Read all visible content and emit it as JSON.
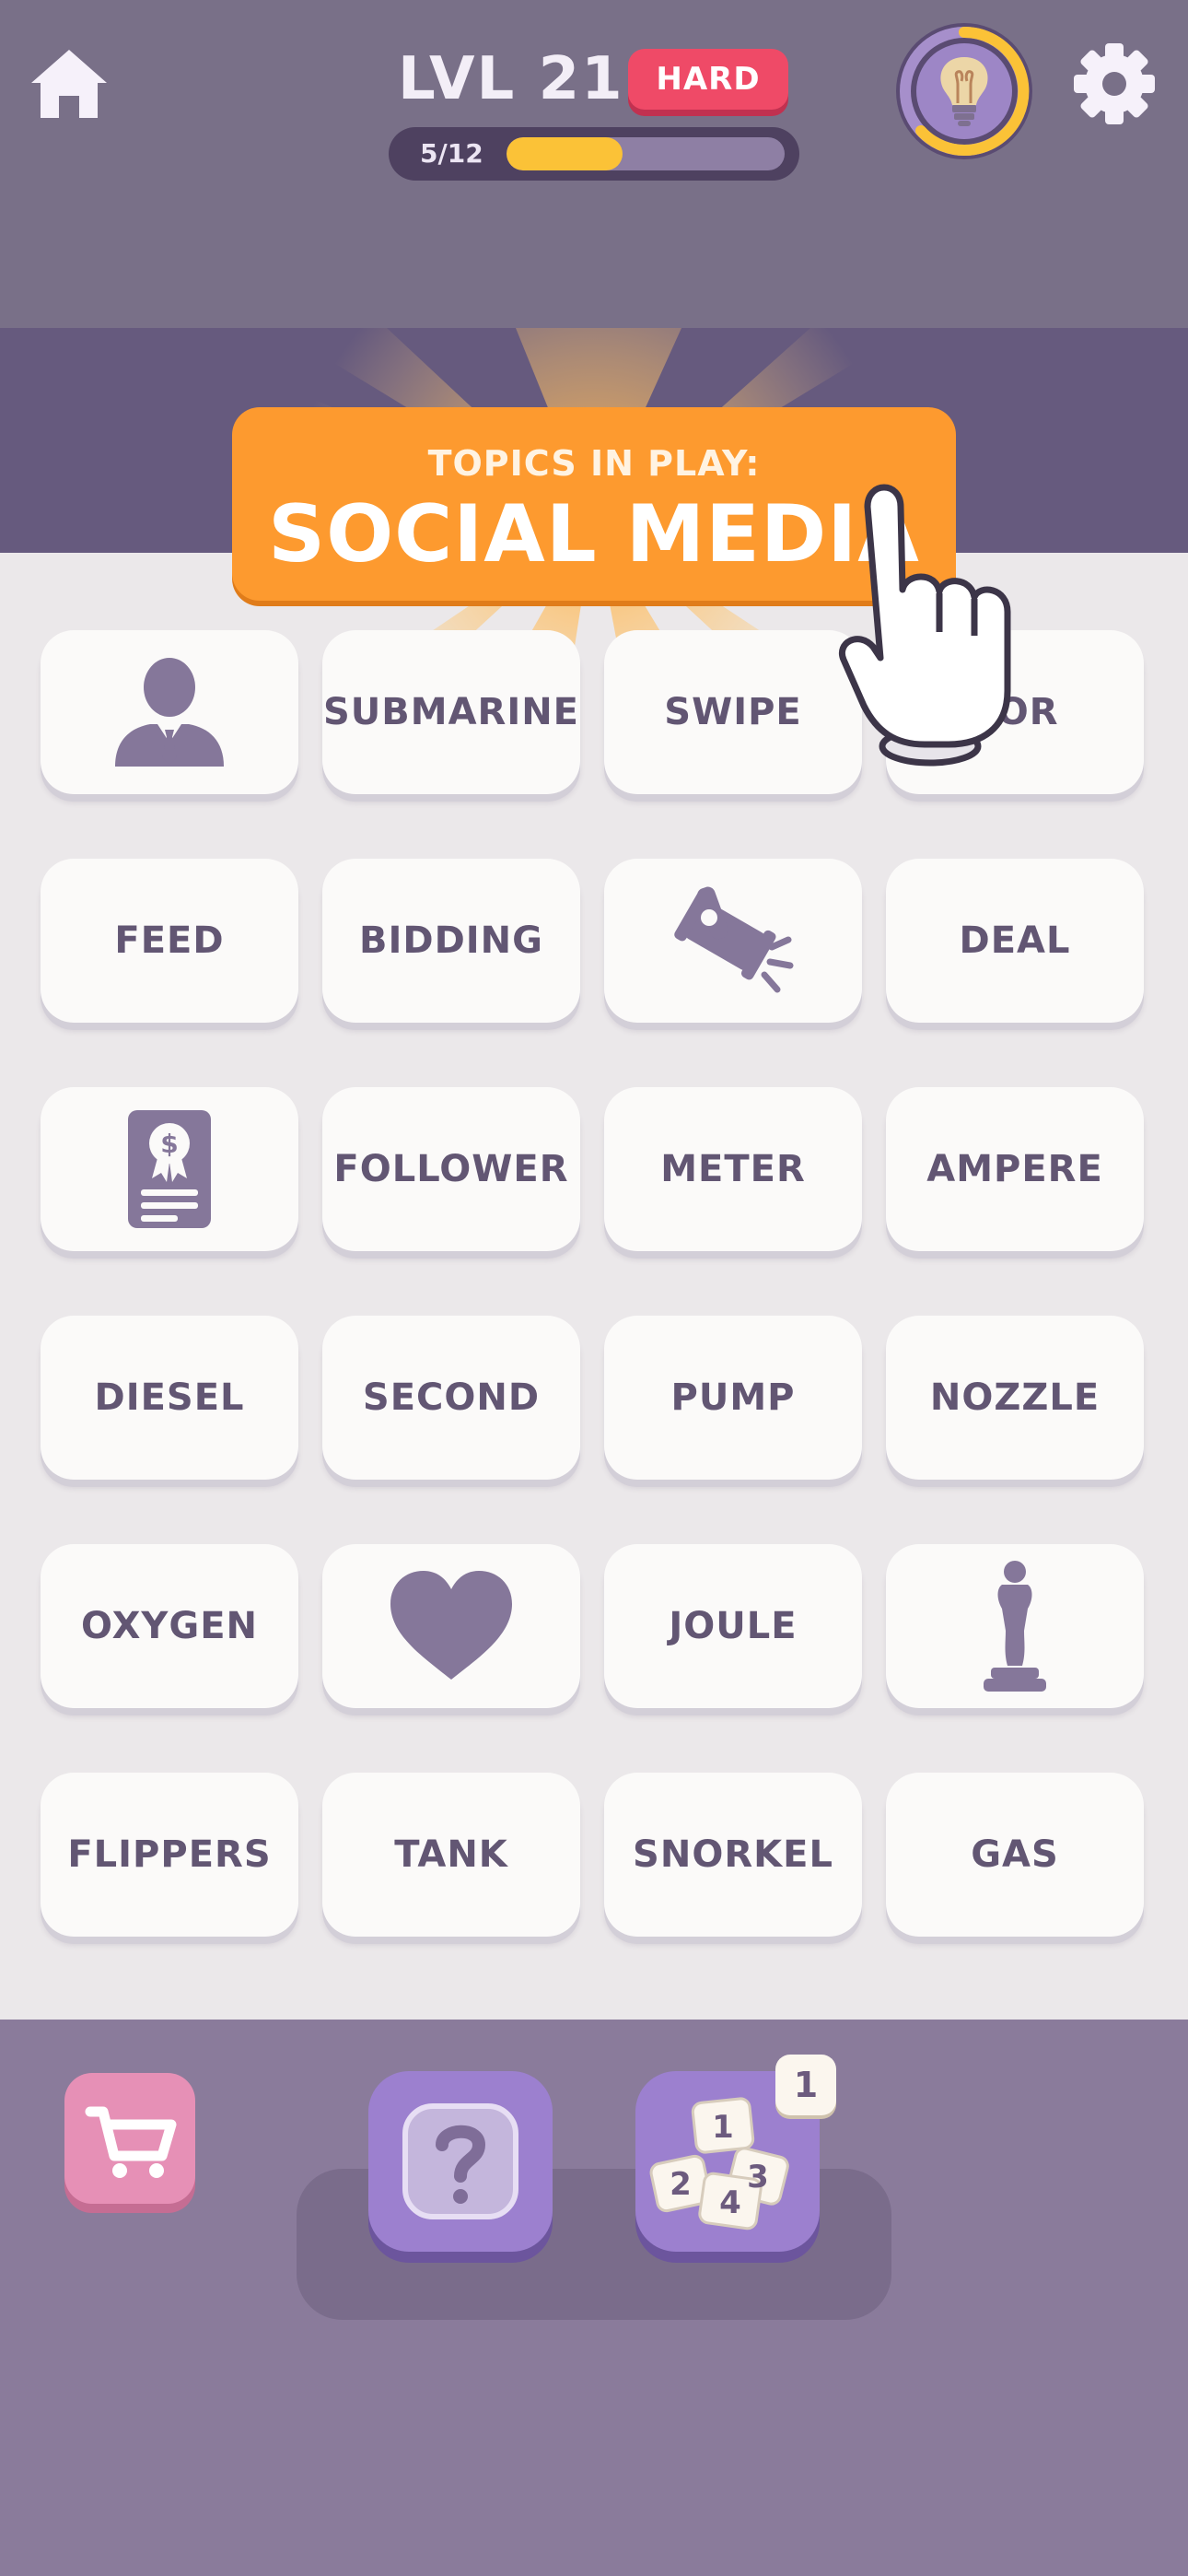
{
  "header": {
    "level_label": "LVL 21",
    "difficulty": "HARD",
    "progress": {
      "label": "5/12",
      "value": 5,
      "max": 12
    }
  },
  "topic": {
    "kicker": "TOPICS IN PLAY:",
    "name": "SOCIAL MEDIA"
  },
  "grid": {
    "rows": [
      [
        {
          "type": "icon",
          "icon": "businessman-icon"
        },
        {
          "type": "word",
          "text": "SUBMARINE"
        },
        {
          "type": "word",
          "text": "SWIPE"
        },
        {
          "type": "word",
          "text": "TOR"
        }
      ],
      [
        {
          "type": "word",
          "text": "FEED"
        },
        {
          "type": "word",
          "text": "BIDDING"
        },
        {
          "type": "icon",
          "icon": "auction-gavel-icon"
        },
        {
          "type": "word",
          "text": "DEAL"
        }
      ],
      [
        {
          "type": "icon",
          "icon": "certificate-icon"
        },
        {
          "type": "word",
          "text": "FOLLOWER"
        },
        {
          "type": "word",
          "text": "METER"
        },
        {
          "type": "word",
          "text": "AMPERE"
        }
      ],
      [
        {
          "type": "word",
          "text": "DIESEL"
        },
        {
          "type": "word",
          "text": "SECOND"
        },
        {
          "type": "word",
          "text": "PUMP"
        },
        {
          "type": "word",
          "text": "NOZZLE"
        }
      ],
      [
        {
          "type": "word",
          "text": "OXYGEN"
        },
        {
          "type": "icon",
          "icon": "heart-icon"
        },
        {
          "type": "word",
          "text": "JOULE"
        },
        {
          "type": "icon",
          "icon": "trophy-statue-icon"
        }
      ],
      [
        {
          "type": "word",
          "text": "FLIPPERS"
        },
        {
          "type": "word",
          "text": "TANK"
        },
        {
          "type": "word",
          "text": "SNORKEL"
        },
        {
          "type": "word",
          "text": "GAS"
        }
      ]
    ]
  },
  "bottom": {
    "shuffle_count": "1"
  },
  "colors": {
    "header_bg": "#797088",
    "accent_orange": "#fd9a2f",
    "hard_red": "#ef4a67",
    "progress_yellow": "#fbc237",
    "tile_text": "#625673",
    "board_bg": "#ebe8ea",
    "bottom_bg": "#8a7b9b"
  }
}
